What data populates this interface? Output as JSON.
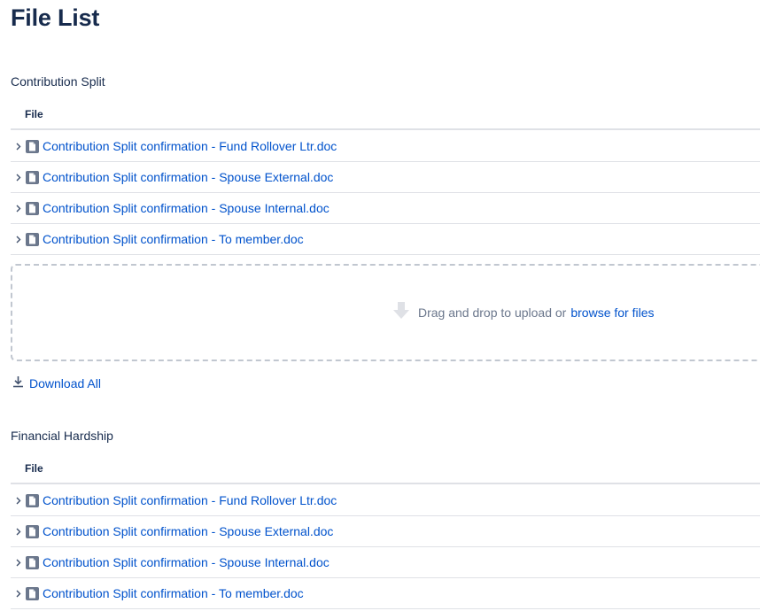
{
  "page": {
    "title": "File List"
  },
  "sections": [
    {
      "label": "Contribution Split",
      "column_header": "File",
      "files": [
        "Contribution Split confirmation - Fund Rollover Ltr.doc",
        "Contribution Split confirmation - Spouse External.doc",
        "Contribution Split confirmation - Spouse Internal.doc",
        "Contribution Split confirmation - To member.doc"
      ],
      "dropzone": {
        "text": "Drag and drop to upload or",
        "browse_label": "browse for files"
      },
      "download_all_label": "Download All"
    },
    {
      "label": "Financial Hardship",
      "column_header": "File",
      "files": [
        "Contribution Split confirmation - Fund Rollover Ltr.doc",
        "Contribution Split confirmation - Spouse External.doc",
        "Contribution Split confirmation - Spouse Internal.doc",
        "Contribution Split confirmation - To member.doc"
      ]
    }
  ],
  "icons": {
    "row_toggle": "chevron-right-icon",
    "file": "document-icon",
    "upload": "arrow-down-icon",
    "download": "download-icon"
  },
  "colors": {
    "heading": "#172b4d",
    "link": "#0052cc",
    "muted": "#6b778c",
    "border": "#dfe1e6",
    "dropzone_border": "#c1c7d0"
  }
}
